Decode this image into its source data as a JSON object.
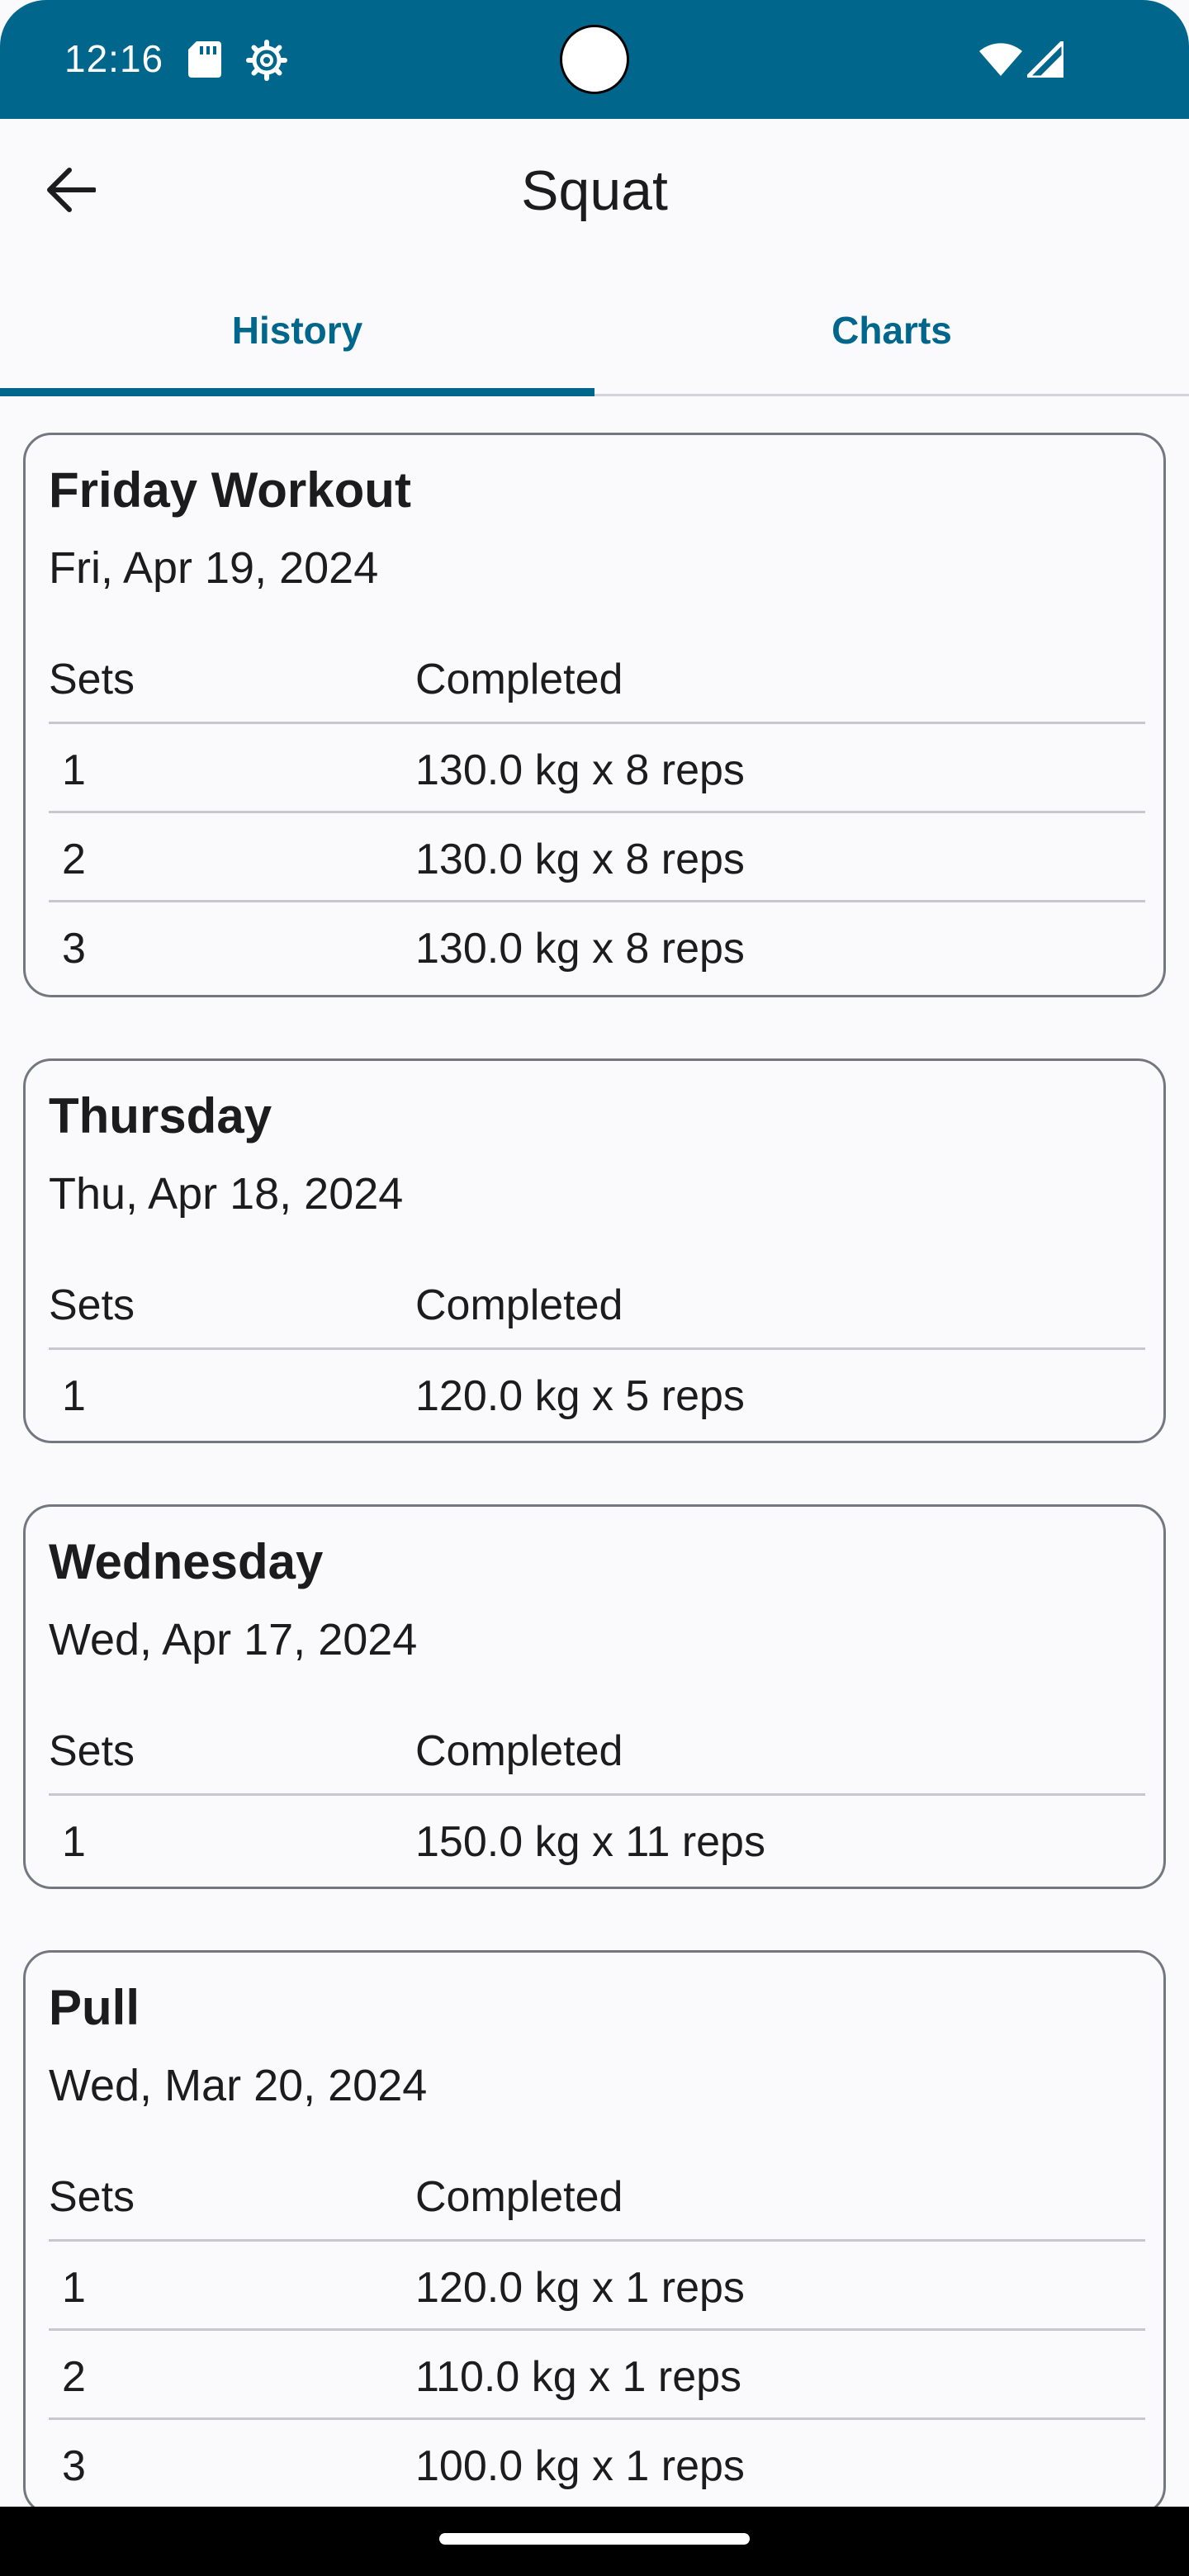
{
  "status_bar": {
    "time": "12:16",
    "icons": [
      "sd-card-icon",
      "settings-gear-icon",
      "wifi-icon",
      "signal-icon"
    ]
  },
  "app_bar": {
    "title": "Squat",
    "back_icon": "arrow-back-icon"
  },
  "tabs": [
    {
      "label": "History",
      "selected": true
    },
    {
      "label": "Charts",
      "selected": false
    }
  ],
  "colors": {
    "primary": "#00668c",
    "background": "#fafafc",
    "card_border": "#74777f",
    "divider": "#c7c7cc"
  },
  "table_headers": {
    "sets": "Sets",
    "completed": "Completed"
  },
  "workouts": [
    {
      "title": "Friday Workout",
      "date": "Fri, Apr 19, 2024",
      "sets": [
        {
          "set": "1",
          "completed": "130.0 kg x 8 reps"
        },
        {
          "set": "2",
          "completed": "130.0 kg x 8 reps"
        },
        {
          "set": "3",
          "completed": "130.0 kg x 8 reps"
        }
      ]
    },
    {
      "title": "Thursday",
      "date": "Thu, Apr 18, 2024",
      "sets": [
        {
          "set": "1",
          "completed": "120.0 kg x 5 reps"
        }
      ]
    },
    {
      "title": "Wednesday",
      "date": "Wed, Apr 17, 2024",
      "sets": [
        {
          "set": "1",
          "completed": "150.0 kg x 11 reps"
        }
      ]
    },
    {
      "title": "Pull",
      "date": "Wed, Mar 20, 2024",
      "sets": [
        {
          "set": "1",
          "completed": "120.0 kg x 1 reps"
        },
        {
          "set": "2",
          "completed": "110.0 kg x 1 reps"
        },
        {
          "set": "3",
          "completed": "100.0 kg x 1 reps"
        }
      ]
    }
  ]
}
